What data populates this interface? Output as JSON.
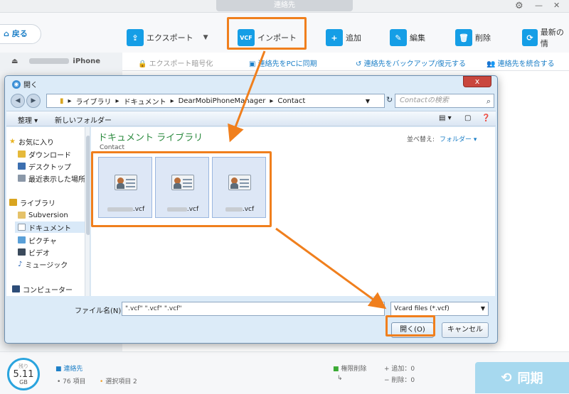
{
  "app": {
    "title": "連絡先",
    "back_label": "戻る",
    "toolbar": {
      "export_label": "エクスポート",
      "import_label": "インポート",
      "add_label": "追加",
      "edit_label": "編集",
      "delete_label": "削除",
      "latest_label": "最新の情"
    },
    "device_name": "iPhone",
    "subbar": {
      "export_encrypt": "エクスポート暗号化",
      "sync_to_pc": "連絡先をPCに同期",
      "backup_restore": "連絡先をバックアップ/復元する",
      "merge": "連絡先を統合する"
    },
    "status": {
      "storage_label": "残り",
      "storage_value": "5.11",
      "storage_unit": "GB",
      "category": "連絡先",
      "item_count": "76 項目",
      "selected": "選択項目 2",
      "permission_delete": "権限削除",
      "add_count": "+ 追加：0",
      "delete_count": "− 削除：0",
      "sync_label": "同期"
    }
  },
  "dialog": {
    "title": "開く",
    "close_label": "x",
    "breadcrumb": [
      "ライブラリ",
      "ドキュメント",
      "DearMobiPhoneManager",
      "Contact"
    ],
    "search_placeholder": "Contactの検索",
    "commands": {
      "organize": "整理",
      "new_folder": "新しいフォルダー"
    },
    "nav": {
      "favorites": "お気に入り",
      "downloads": "ダウンロード",
      "desktop": "デスクトップ",
      "recent": "最近表示した場所",
      "libraries": "ライブラリ",
      "subversion": "Subversion",
      "documents": "ドキュメント",
      "pictures": "ピクチャ",
      "videos": "ビデオ",
      "music": "ミュージック",
      "computer": "コンピューター"
    },
    "library_title": "ドキュメント ライブラリ",
    "library_sub": "Contact",
    "sort_label": "並べ替え:",
    "sort_value": "フォルダー",
    "files": [
      {
        "name": ".vcf"
      },
      {
        "name": ".vcf"
      },
      {
        "name": ".vcf"
      }
    ],
    "filename_label": "ファイル名(N):",
    "filename_value": "\".vcf\" \".vcf\" \".vcf\"",
    "file_type": "Vcard files (*.vcf)",
    "open_label": "開く(O)",
    "cancel_label": "キャンセル"
  },
  "colors": {
    "accent": "#159ee6",
    "highlight": "#f07f1d",
    "library_title": "#2b8a3e"
  }
}
